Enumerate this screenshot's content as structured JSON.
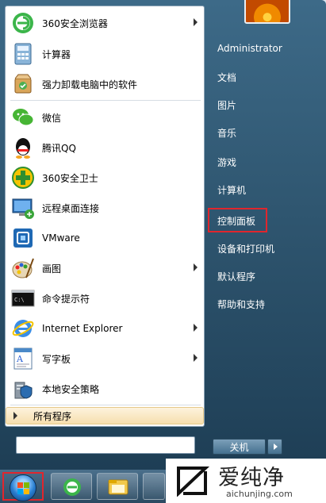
{
  "programs": [
    {
      "label": "360安全浏览器",
      "icon": "360-browser-icon",
      "submenu": true
    },
    {
      "label": "计算器",
      "icon": "calculator-icon",
      "submenu": false
    },
    {
      "label": "强力卸载电脑中的软件",
      "icon": "uninstall-icon",
      "submenu": false
    },
    {
      "label": "微信",
      "icon": "wechat-icon",
      "submenu": false
    },
    {
      "label": "腾讯QQ",
      "icon": "qq-icon",
      "submenu": false
    },
    {
      "label": "360安全卫士",
      "icon": "360-safe-icon",
      "submenu": false
    },
    {
      "label": "远程桌面连接",
      "icon": "remote-desktop-icon",
      "submenu": false
    },
    {
      "label": "VMware",
      "icon": "vmware-icon",
      "submenu": false
    },
    {
      "label": "画图",
      "icon": "paint-icon",
      "submenu": true
    },
    {
      "label": "命令提示符",
      "icon": "cmd-icon",
      "submenu": false
    },
    {
      "label": "Internet Explorer",
      "icon": "ie-icon",
      "submenu": true
    },
    {
      "label": "写字板",
      "icon": "wordpad-icon",
      "submenu": true
    },
    {
      "label": "本地安全策略",
      "icon": "security-policy-icon",
      "submenu": false
    }
  ],
  "all_programs": "所有程序",
  "right_items": [
    "Administrator",
    "文档",
    "图片",
    "音乐",
    "游戏",
    "计算机",
    "控制面板",
    "设备和打印机",
    "默认程序",
    "帮助和支持"
  ],
  "shutdown_label": "关机",
  "cmd_icon_text": "C:\\",
  "watermark": {
    "text": "爱纯净",
    "url": "aichunjing.com"
  },
  "colors": {
    "highlight_border": "#e0262d",
    "all_programs_bg": "#f6dfae"
  }
}
